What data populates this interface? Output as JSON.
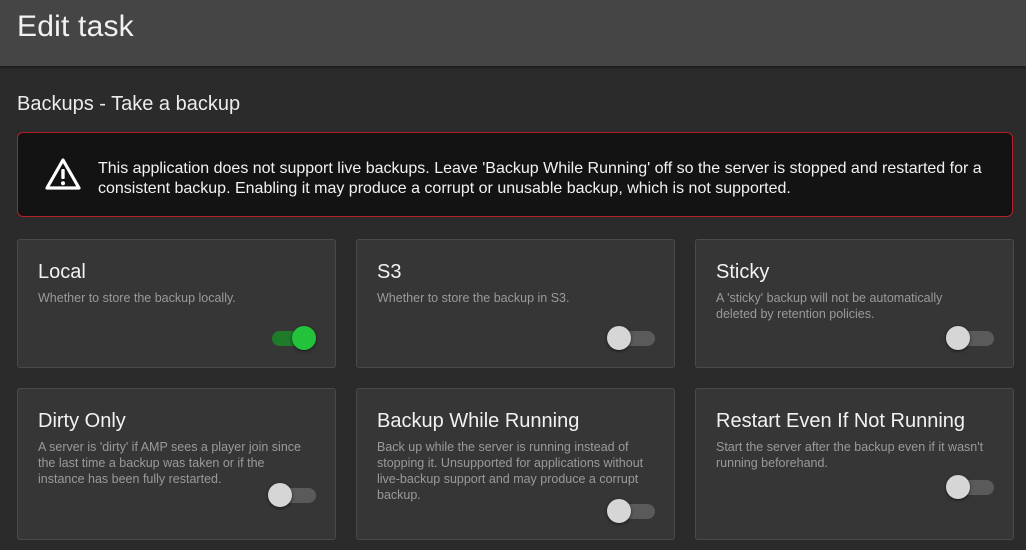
{
  "header": {
    "title": "Edit task"
  },
  "section": {
    "subtitle": "Backups - Take a backup"
  },
  "warning": {
    "text": "This application does not support live backups. Leave 'Backup While Running' off so the server is stopped and restarted for a consistent backup. Enabling it may produce a corrupt or unusable backup, which is not supported.",
    "border_color": "#b3202a"
  },
  "options": [
    {
      "title": "Local",
      "description": "Whether to store the backup locally.",
      "enabled": true
    },
    {
      "title": "S3",
      "description": "Whether to store the backup in S3.",
      "enabled": false
    },
    {
      "title": "Sticky",
      "description": "A 'sticky' backup will not be automatically deleted by retention policies.",
      "enabled": false
    },
    {
      "title": "Dirty Only",
      "description": "A server is 'dirty' if AMP sees a player join since the last time a backup was taken or if the instance has been fully restarted.",
      "enabled": false
    },
    {
      "title": "Backup While Running",
      "description": "Back up while the server is running instead of stopping it. Unsupported for applications without live-backup support and may produce a corrupt backup.",
      "enabled": false
    },
    {
      "title": "Restart Even If Not Running",
      "description": "Start the server after the backup even if it wasn't running beforehand.",
      "enabled": false
    }
  ],
  "colors": {
    "toggle_on": "#22c23a",
    "toggle_off": "#d6d6d6",
    "background": "#2b2b2b",
    "header": "#454545"
  }
}
